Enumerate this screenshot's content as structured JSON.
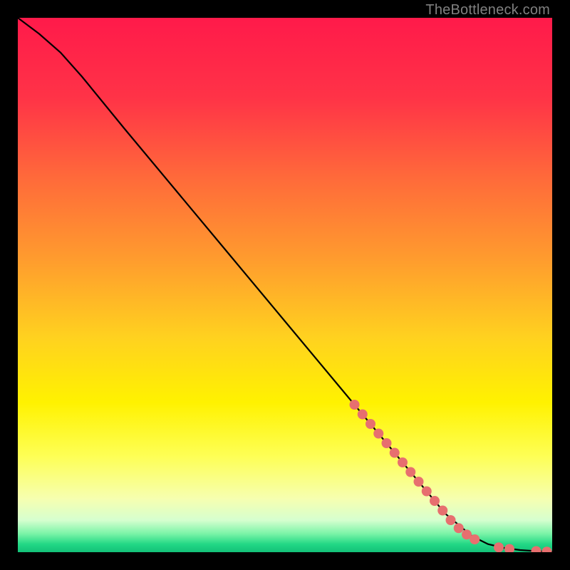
{
  "attribution": "TheBottleneck.com",
  "chart_data": {
    "type": "line",
    "title": "",
    "xlabel": "",
    "ylabel": "",
    "xlim": [
      0,
      100
    ],
    "ylim": [
      0,
      100
    ],
    "background_gradient_stops": [
      {
        "offset": 0.0,
        "color": "#ff1a4a"
      },
      {
        "offset": 0.15,
        "color": "#ff3347"
      },
      {
        "offset": 0.3,
        "color": "#ff6a3a"
      },
      {
        "offset": 0.45,
        "color": "#ff9b2e"
      },
      {
        "offset": 0.6,
        "color": "#ffd21f"
      },
      {
        "offset": 0.72,
        "color": "#fff200"
      },
      {
        "offset": 0.82,
        "color": "#feff55"
      },
      {
        "offset": 0.9,
        "color": "#f6ffb0"
      },
      {
        "offset": 0.94,
        "color": "#d6ffcf"
      },
      {
        "offset": 0.965,
        "color": "#7cf4a8"
      },
      {
        "offset": 0.985,
        "color": "#22d885"
      },
      {
        "offset": 1.0,
        "color": "#13c178"
      }
    ],
    "curve": {
      "x": [
        0,
        4,
        8,
        12,
        20,
        30,
        40,
        50,
        60,
        70,
        80,
        85,
        88,
        91,
        94,
        97,
        100
      ],
      "y": [
        100,
        97,
        93.5,
        89,
        79.2,
        67.2,
        55.2,
        43.2,
        31.2,
        19.2,
        7.2,
        3.0,
        1.5,
        0.8,
        0.4,
        0.2,
        0.1
      ]
    },
    "markers": {
      "x": [
        63,
        64.5,
        66,
        67.5,
        69,
        70.5,
        72,
        73.5,
        75,
        76.5,
        78,
        79.5,
        81,
        82.5,
        84,
        85.5,
        90,
        92,
        97,
        99
      ],
      "y": [
        27.6,
        25.8,
        24.0,
        22.2,
        20.4,
        18.6,
        16.8,
        15.0,
        13.2,
        11.4,
        9.6,
        7.8,
        6.0,
        4.5,
        3.3,
        2.4,
        0.9,
        0.6,
        0.2,
        0.1
      ],
      "color": "#e76f6f",
      "radius": 7
    }
  }
}
